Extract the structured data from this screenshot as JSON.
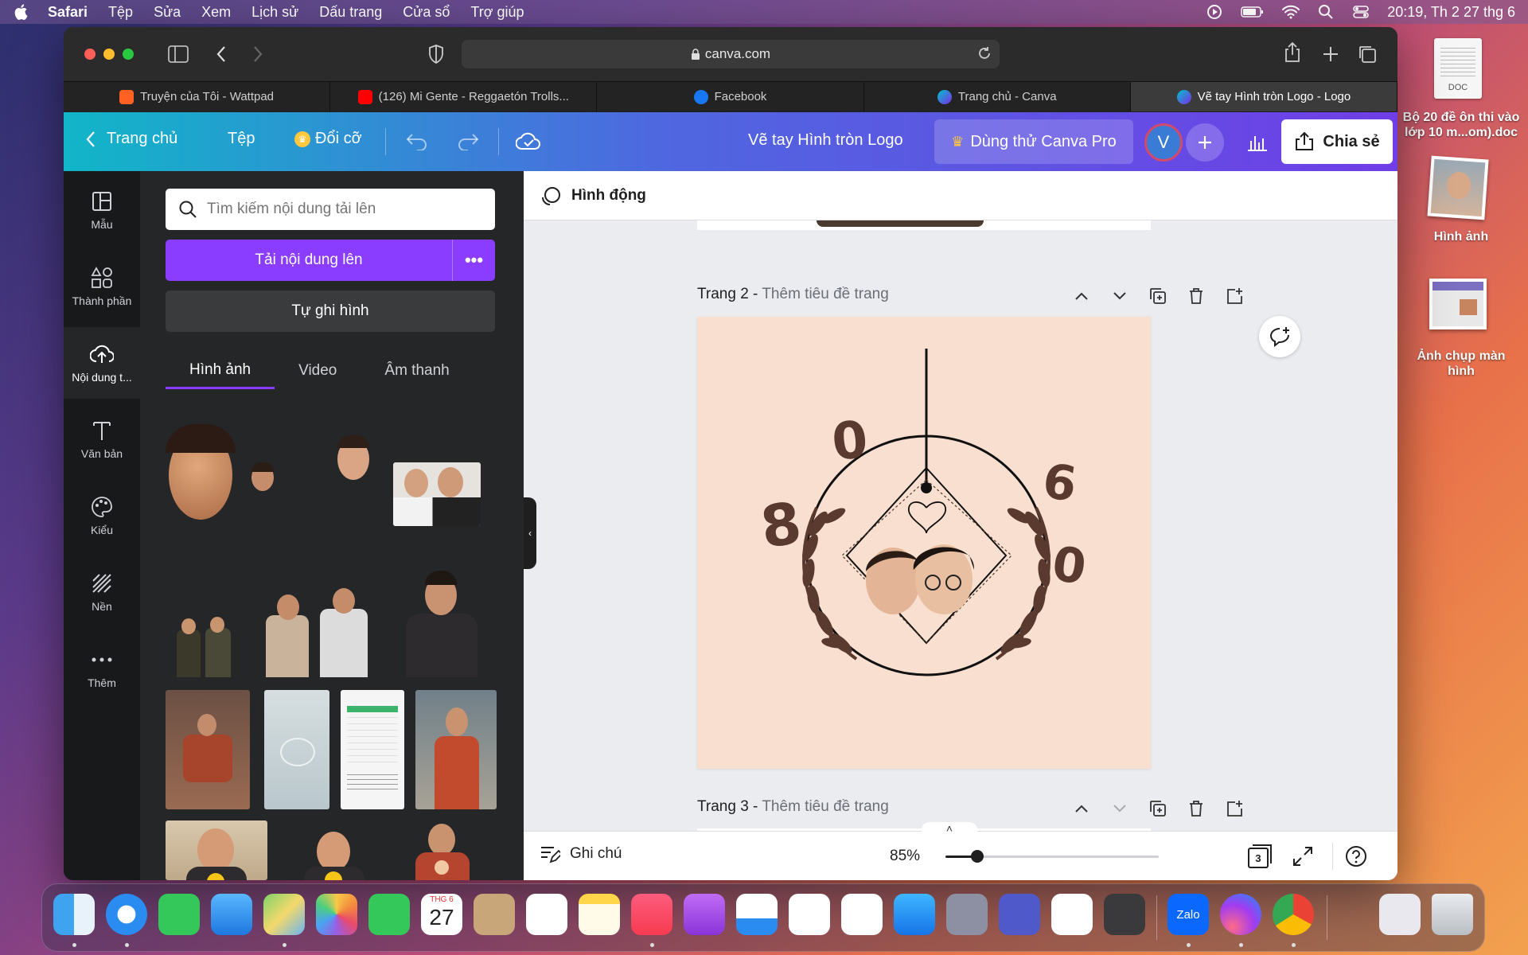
{
  "menubar": {
    "app_name": "Safari",
    "menus": [
      "Tệp",
      "Sửa",
      "Xem",
      "Lịch sử",
      "Dấu trang",
      "Cửa sổ",
      "Trợ giúp"
    ],
    "clock": "20:19, Th 2 27 thg 6"
  },
  "browser": {
    "url": "canva.com",
    "tabs": [
      {
        "label": "Truyện của Tôi - Wattpad",
        "icon": "wattpad-icon"
      },
      {
        "label": "(126) Mi Gente - Reggaetón Trolls...",
        "icon": "youtube-icon"
      },
      {
        "label": "Facebook",
        "icon": "facebook-icon"
      },
      {
        "label": "Trang chủ - Canva",
        "icon": "canva-icon"
      },
      {
        "label": "Vẽ tay Hình tròn Logo - Logo",
        "icon": "canva-icon",
        "active": true
      }
    ]
  },
  "canva_header": {
    "home": "Trang chủ",
    "file": "Tệp",
    "resize": "Đổi cỡ",
    "design_title": "Vẽ tay Hình tròn Logo",
    "pro_button": "Dùng thử Canva Pro",
    "avatar_initial": "V",
    "share": "Chia sẻ"
  },
  "rail": {
    "items": [
      {
        "label": "Mẫu",
        "icon": "template-icon"
      },
      {
        "label": "Thành phần",
        "icon": "elements-icon"
      },
      {
        "label": "Nội dung t...",
        "icon": "upload-cloud-icon",
        "active": true
      },
      {
        "label": "Văn bản",
        "icon": "text-icon"
      },
      {
        "label": "Kiểu",
        "icon": "palette-icon"
      },
      {
        "label": "Nền",
        "icon": "background-icon"
      },
      {
        "label": "Thêm",
        "icon": "more-icon"
      }
    ]
  },
  "panel": {
    "search_placeholder": "Tìm kiếm nội dung tải lên",
    "upload_button": "Tải nội dung lên",
    "record_button": "Tự ghi hình",
    "tabs": [
      "Hình ảnh",
      "Video",
      "Âm thanh"
    ]
  },
  "editor": {
    "animate_label": "Hình động",
    "page2_label": "Trang 2 - ",
    "page2_sub": "Thêm tiêu đề trang",
    "page3_label": "Trang 3 - ",
    "page3_sub": "Thêm tiêu đề trang",
    "canvas_digits": [
      "0",
      "8",
      "6",
      "0"
    ],
    "notes": "Ghi chú",
    "zoom": "85%",
    "zoom_level": 0.15,
    "page_count": "3"
  },
  "desktop": {
    "files": [
      {
        "label": "Bộ 20 đề ôn thi vào lớp 10 m...om).doc",
        "icon": "doc-file-icon",
        "badge": "DOC"
      },
      {
        "label": "Hình ảnh",
        "icon": "photo-file-icon"
      },
      {
        "label": "Ảnh chụp màn hình",
        "icon": "screenshot-file-icon"
      }
    ]
  },
  "dock": {
    "calendar_month": "THG 6",
    "calendar_day": "27",
    "zalo_label": "Zalo"
  },
  "colors": {
    "canva_purple": "#8b3dff",
    "canvas_bg": "#f9dfcf",
    "logo_brown": "#5a3a2e"
  }
}
